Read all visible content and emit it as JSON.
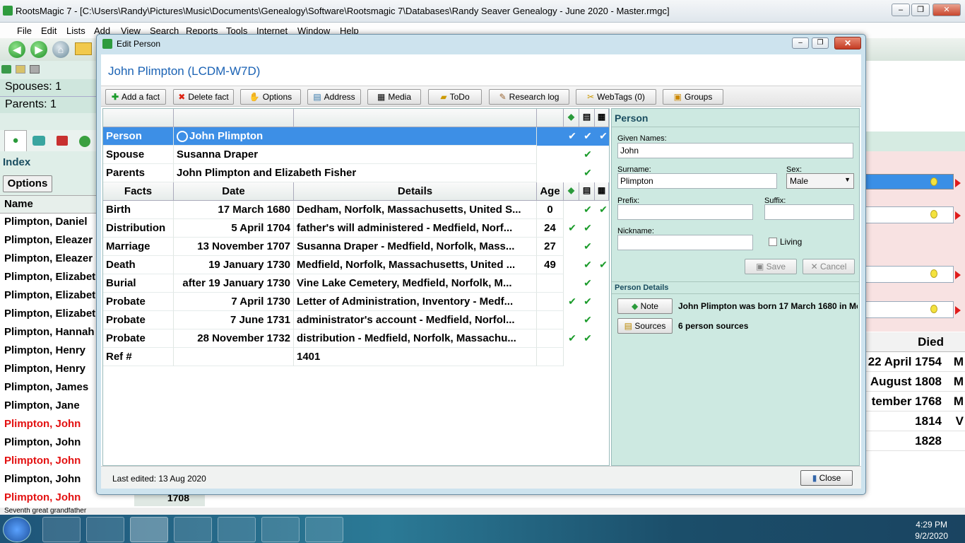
{
  "window": {
    "title": "RootsMagic 7 - [C:\\Users\\Randy\\Pictures\\Music\\Documents\\Genealogy\\Software\\Rootsmagic 7\\Databases\\Randy Seaver Genealogy - June 2020 - Master.rmgc]"
  },
  "menu": [
    "File",
    "Edit",
    "Lists",
    "Add",
    "View",
    "Search",
    "Reports",
    "Tools",
    "Internet",
    "Window",
    "Help"
  ],
  "left": {
    "spouses": "Spouses: 1",
    "parents": "Parents: 1",
    "index_title": "Index",
    "options_label": "Options",
    "name_header": "Name",
    "names": [
      {
        "text": "Plimpton, Daniel",
        "red": false
      },
      {
        "text": "Plimpton, Eleazer",
        "red": false
      },
      {
        "text": "Plimpton, Eleazer",
        "red": false
      },
      {
        "text": "Plimpton, Elizabeth",
        "red": false
      },
      {
        "text": "Plimpton, Elizabeth",
        "red": false
      },
      {
        "text": "Plimpton, Elizabeth",
        "red": false
      },
      {
        "text": "Plimpton, Hannah",
        "red": false
      },
      {
        "text": "Plimpton, Henry",
        "red": false
      },
      {
        "text": "Plimpton, Henry",
        "red": false
      },
      {
        "text": "Plimpton, James",
        "red": false
      },
      {
        "text": "Plimpton, Jane",
        "red": false
      },
      {
        "text": "Plimpton, John",
        "red": true
      },
      {
        "text": "Plimpton, John",
        "red": false
      },
      {
        "text": "Plimpton, John",
        "red": true
      },
      {
        "text": "Plimpton, John",
        "red": false
      },
      {
        "text": "Plimpton, John",
        "red": true
      }
    ],
    "year": "1708",
    "status": "Seventh great grandfather"
  },
  "right": {
    "died_header": "Died",
    "died": [
      "22 April 1754",
      "August 1808",
      "tember 1768",
      "1814",
      "1828"
    ],
    "died_tail": [
      "M",
      "M",
      "M",
      "V",
      ""
    ]
  },
  "dialog": {
    "title": "Edit Person",
    "person_header": "John Plimpton (LCDM-W7D)",
    "buttons": [
      "Add a fact",
      "Delete fact",
      "Options",
      "Address",
      "Media",
      "ToDo",
      "Research log",
      "WebTags (0)",
      "Groups"
    ],
    "top_rows": [
      {
        "label": "Person",
        "value": "John Plimpton",
        "c1": true,
        "c2": true,
        "c3": true
      },
      {
        "label": "Spouse",
        "value": "Susanna Draper",
        "c1": false,
        "c2": true,
        "c3": false
      },
      {
        "label": "Parents",
        "value": "John Plimpton and Elizabeth Fisher",
        "c1": false,
        "c2": true,
        "c3": false
      }
    ],
    "fact_headers": {
      "facts": "Facts",
      "date": "Date",
      "details": "Details",
      "age": "Age"
    },
    "facts": [
      {
        "fact": "Birth",
        "date": "17 March 1680",
        "details": "Dedham, Norfolk, Massachusetts, United S...",
        "age": "0",
        "c1": false,
        "c2": true,
        "c3": true
      },
      {
        "fact": "Distribution",
        "date": "5 April 1704",
        "details": "father's will administered - Medfield, Norf...",
        "age": "24",
        "c1": true,
        "c2": true,
        "c3": false
      },
      {
        "fact": "Marriage",
        "date": "13 November 1707",
        "details": "Susanna Draper - Medfield, Norfolk, Mass...",
        "age": "27",
        "c1": false,
        "c2": true,
        "c3": false
      },
      {
        "fact": "Death",
        "date": "19 January 1730",
        "details": "Medfield, Norfolk, Massachusetts, United ...",
        "age": "49",
        "c1": false,
        "c2": true,
        "c3": true
      },
      {
        "fact": "Burial",
        "date": "after 19 January 1730",
        "details": "Vine Lake Cemetery, Medfield, Norfolk, M...",
        "age": "",
        "c1": false,
        "c2": true,
        "c3": false
      },
      {
        "fact": "Probate",
        "date": "7 April 1730",
        "details": "Letter of Administration, Inventory - Medf...",
        "age": "",
        "c1": true,
        "c2": true,
        "c3": false
      },
      {
        "fact": "Probate",
        "date": "7 June 1731",
        "details": "administrator's account - Medfield, Norfol...",
        "age": "",
        "c1": false,
        "c2": true,
        "c3": false
      },
      {
        "fact": "Probate",
        "date": "28 November 1732",
        "details": "distribution - Medfield, Norfolk, Massachu...",
        "age": "",
        "c1": true,
        "c2": true,
        "c3": false
      },
      {
        "fact": "Ref #",
        "date": "",
        "details": "1401",
        "age": "",
        "c1": false,
        "c2": false,
        "c3": false
      }
    ],
    "last_edited": "Last edited: 13 Aug 2020",
    "close_label": "Close",
    "panel": {
      "title": "Person",
      "given_label": "Given Names:",
      "given": "John",
      "surname_label": "Surname:",
      "surname": "Plimpton",
      "sex_label": "Sex:",
      "sex": "Male",
      "prefix_label": "Prefix:",
      "suffix_label": "Suffix:",
      "nickname_label": "Nickname:",
      "living_label": "Living",
      "save_label": "Save",
      "cancel_label": "Cancel",
      "details_title": "Person Details",
      "note_label": "Note",
      "note_text": "John Plimpton was born 17 March 1680 in Me",
      "sources_label": "Sources",
      "sources_text": "6 person sources"
    }
  },
  "taskbar": {
    "time": "4:29 PM",
    "date": "9/2/2020"
  }
}
